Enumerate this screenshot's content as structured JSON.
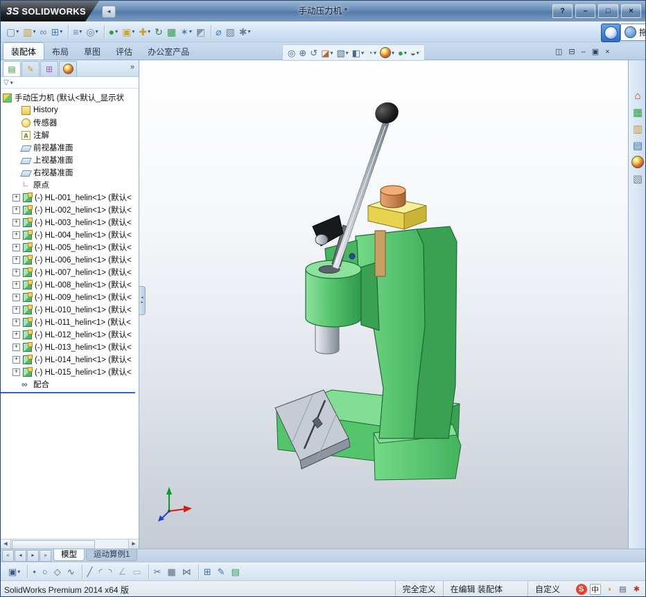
{
  "titlebar": {
    "logo": "3S",
    "brand": "SOLIDWORKS",
    "title": "手动压力机 *",
    "controls": [
      {
        "name": "help-button",
        "glyph": "?"
      },
      {
        "name": "minimize-button",
        "glyph": "–"
      },
      {
        "name": "maximize-button",
        "glyph": "□"
      },
      {
        "name": "close-button",
        "glyph": "×"
      }
    ]
  },
  "main_toolbar": {
    "icons": [
      {
        "name": "new-document-icon",
        "glyph": "▢",
        "color": "#7d8893",
        "caret": true
      },
      {
        "name": "open-document-icon",
        "glyph": "▥",
        "color": "#c9992e",
        "caret": true
      },
      {
        "name": "attachment-icon",
        "glyph": "∞",
        "color": "#70809a"
      },
      {
        "name": "component-pattern-icon",
        "glyph": "⊞",
        "color": "#3f7fbf",
        "caret": true
      },
      {
        "sep": true
      },
      {
        "name": "print-icon",
        "glyph": "≡",
        "color": "#70809a",
        "caret": true
      },
      {
        "name": "print-preview-icon",
        "glyph": "◎",
        "color": "#70809a",
        "caret": true
      },
      {
        "sep": true
      },
      {
        "name": "apply-scene-icon",
        "glyph": "●",
        "color": "#2f9e44",
        "caret": true
      },
      {
        "name": "insert-components-icon",
        "glyph": "▣",
        "color": "#caa53d",
        "caret": true
      },
      {
        "name": "smart-fasteners-icon",
        "glyph": "✚",
        "color": "#d29a2b",
        "caret": true
      },
      {
        "name": "rebuild-icon",
        "glyph": "↻",
        "color": "#2e7f52"
      },
      {
        "name": "design-table-icon",
        "glyph": "▦",
        "color": "#2f9e44"
      },
      {
        "name": "exploded-view-icon",
        "glyph": "✶",
        "color": "#3f7fbf",
        "caret": true
      },
      {
        "name": "interference-detection-icon",
        "glyph": "◩",
        "color": "#8a93a0"
      },
      {
        "sep": true
      },
      {
        "name": "measure-icon",
        "glyph": "⌀",
        "color": "#3f7fbf"
      },
      {
        "name": "section-properties-icon",
        "glyph": "▨",
        "color": "#70809a"
      },
      {
        "name": "options-icon",
        "glyph": "✱",
        "color": "#70809a",
        "caret": true
      }
    ]
  },
  "drag_hint": {
    "label": "拖拽"
  },
  "command_tabs": [
    {
      "name": "tab-assembly",
      "label": "装配体",
      "active": true
    },
    {
      "name": "tab-layout",
      "label": "布局"
    },
    {
      "name": "tab-sketch",
      "label": "草图"
    },
    {
      "name": "tab-evaluate",
      "label": "评估"
    },
    {
      "name": "tab-office-products",
      "label": "办公室产品"
    }
  ],
  "view_toolbar": {
    "icons": [
      {
        "name": "zoom-to-fit-icon",
        "glyph": "◎",
        "color": "#3f6fa0"
      },
      {
        "name": "zoom-to-area-icon",
        "glyph": "⊕",
        "color": "#3f6fa0"
      },
      {
        "name": "previous-view-icon",
        "glyph": "↺",
        "color": "#3f6fa0"
      },
      {
        "name": "section-view-icon",
        "glyph": "◪",
        "color": "#b06a3a",
        "caret": true
      },
      {
        "name": "view-orientation-icon",
        "glyph": "▧",
        "color": "#4a6b8a",
        "caret": true
      },
      {
        "name": "display-style-icon",
        "glyph": "◧",
        "color": "#4a6b8a",
        "caret": true
      },
      {
        "name": "hide-show-items-icon",
        "glyph": "◔",
        "color": "#7a8694",
        "caret": true
      },
      {
        "name": "edit-appearance-icon",
        "ball": true,
        "caret": true
      },
      {
        "name": "apply-scene-view-icon",
        "glyph": "●",
        "color": "#2f9e44",
        "caret": true
      },
      {
        "name": "view-settings-icon",
        "glyph": "◒",
        "color": "#4a6b8a",
        "caret": true
      }
    ]
  },
  "doc_controls": [
    {
      "name": "split-view-icon",
      "glyph": "◫",
      "color": "#27415e"
    },
    {
      "name": "tile-view-icon",
      "glyph": "⊟",
      "color": "#27415e"
    },
    {
      "name": "doc-minimize-icon",
      "glyph": "–",
      "color": "#27415e"
    },
    {
      "name": "doc-restore-icon",
      "glyph": "▣",
      "color": "#27415e"
    },
    {
      "name": "doc-close-icon",
      "glyph": "×",
      "color": "#27415e"
    }
  ],
  "panel": {
    "flyout": "»",
    "filter_funnel": "▽",
    "filter_caret": "▾",
    "tabs": [
      {
        "name": "featuremanager-tab",
        "glyph": "▤",
        "color": "#2f9e44",
        "active": true
      },
      {
        "name": "propertymanager-tab",
        "glyph": "✎",
        "color": "#d4a017"
      },
      {
        "name": "configurationmanager-tab",
        "glyph": "⊞",
        "color": "#9b59b6"
      },
      {
        "name": "appearances-tab",
        "ball": true
      }
    ]
  },
  "tree": {
    "root": {
      "label": "手动压力机 (默认<默认_显示状",
      "icon": "assembly"
    },
    "items": [
      {
        "label": "History",
        "icon": "history"
      },
      {
        "label": "传感器",
        "icon": "sensors"
      },
      {
        "label": "注解",
        "icon": "annotations"
      },
      {
        "label": "前视基准面",
        "icon": "plane"
      },
      {
        "label": "上视基准面",
        "icon": "plane"
      },
      {
        "label": "右视基准面",
        "icon": "plane"
      },
      {
        "label": "原点",
        "icon": "origin"
      },
      {
        "label": "(-) HL-001_helin<1> (默认<",
        "icon": "component",
        "expandable": true
      },
      {
        "label": "(-) HL-002_helin<1> (默认<",
        "icon": "component",
        "expandable": true
      },
      {
        "label": "(-) HL-003_helin<1> (默认<",
        "icon": "component",
        "expandable": true
      },
      {
        "label": "(-) HL-004_helin<1> (默认<",
        "icon": "component",
        "expandable": true
      },
      {
        "label": "(-) HL-005_helin<1> (默认<",
        "icon": "component",
        "expandable": true
      },
      {
        "label": "(-) HL-006_helin<1> (默认<",
        "icon": "component",
        "expandable": true
      },
      {
        "label": "(-) HL-007_helin<1> (默认<",
        "icon": "component",
        "expandable": true
      },
      {
        "label": "(-) HL-008_helin<1> (默认<",
        "icon": "component",
        "expandable": true
      },
      {
        "label": "(-) HL-009_helin<1> (默认<",
        "icon": "component",
        "expandable": true
      },
      {
        "label": "(-) HL-010_helin<1> (默认<",
        "icon": "component",
        "expandable": true
      },
      {
        "label": "(-) HL-011_helin<1> (默认<",
        "icon": "component",
        "expandable": true
      },
      {
        "label": "(-) HL-012_helin<1> (默认<",
        "icon": "component",
        "expandable": true
      },
      {
        "label": "(-) HL-013_helin<1> (默认<",
        "icon": "component",
        "expandable": true
      },
      {
        "label": "(-) HL-014_helin<1> (默认<",
        "icon": "component",
        "expandable": true
      },
      {
        "label": "(-) HL-015_helin<1> (默认<",
        "icon": "component",
        "expandable": true
      },
      {
        "label": "配合",
        "icon": "mates"
      }
    ]
  },
  "task_pane": {
    "icons": [
      {
        "name": "home-icon",
        "glyph": "⌂",
        "color": "#c0392b"
      },
      {
        "name": "solidworks-resources-icon",
        "glyph": "▦",
        "color": "#2f9e44"
      },
      {
        "name": "design-library-icon",
        "glyph": "▥",
        "color": "#c9992e"
      },
      {
        "name": "file-explorer-icon",
        "glyph": "▤",
        "color": "#3f6fa0"
      },
      {
        "name": "appearances-scenes-icon",
        "ball": true
      },
      {
        "name": "custom-properties-icon",
        "glyph": "▧",
        "color": "#7a8694"
      }
    ]
  },
  "bottom_tabs": {
    "nav": [
      {
        "name": "first-tab-button",
        "glyph": "«"
      },
      {
        "name": "previous-tab-button",
        "glyph": "◂"
      },
      {
        "name": "next-tab-button",
        "glyph": "▸"
      },
      {
        "name": "last-tab-button",
        "glyph": "»"
      }
    ],
    "tabs": [
      {
        "name": "tab-model",
        "label": "模型",
        "active": true
      },
      {
        "name": "tab-motion-study-1",
        "label": "运动算例1"
      }
    ]
  },
  "sketch_toolbar": {
    "icons": [
      {
        "name": "save-icon",
        "glyph": "▣",
        "color": "#3b5f8f",
        "caret": true
      },
      {
        "sep": true
      },
      {
        "name": "point-icon",
        "glyph": "•",
        "color": "#5a6b7d"
      },
      {
        "name": "circle-icon",
        "glyph": "○",
        "color": "#5a6b7d"
      },
      {
        "name": "polygon-icon",
        "glyph": "◇",
        "color": "#5a6b7d"
      },
      {
        "name": "spline-icon",
        "glyph": "∿",
        "color": "#5a6b7d"
      },
      {
        "sep": true
      },
      {
        "name": "line-icon",
        "glyph": "╱",
        "color": "#5a6b7d"
      },
      {
        "name": "arc-icon",
        "glyph": "◜",
        "color": "#5a6b7d"
      },
      {
        "name": "tangent-arc-icon",
        "glyph": "◝",
        "color": "#5a6b7d"
      },
      {
        "name": "angle-snap-icon",
        "glyph": "∠",
        "color": "#9fb0c0"
      },
      {
        "name": "rectangle-icon",
        "glyph": "▭",
        "color": "#9fb0c0"
      },
      {
        "sep": true
      },
      {
        "name": "trim-entities-icon",
        "glyph": "✂",
        "color": "#5a6b7d"
      },
      {
        "name": "linear-pattern-icon",
        "glyph": "▦",
        "color": "#5a6b7d"
      },
      {
        "name": "mirror-entities-icon",
        "glyph": "⋈",
        "color": "#5a6b7d"
      },
      {
        "sep": true
      },
      {
        "name": "grid-system-icon",
        "glyph": "⊞",
        "color": "#3f6fa0"
      },
      {
        "name": "instant2d-icon",
        "glyph": "✎",
        "color": "#3f6fa0"
      },
      {
        "name": "table-icon",
        "glyph": "▤",
        "color": "#2f9e44"
      }
    ]
  },
  "statusbar": {
    "left": "SolidWorks Premium 2014 x64 版",
    "segments": [
      {
        "label": "完全定义"
      },
      {
        "label": "在编辑 装配体"
      },
      {
        "label": "自定义"
      }
    ],
    "ime": [
      {
        "name": "ime-sogou-icon",
        "glyph": "S",
        "bg": "#e2442f",
        "fg": "#ffffff",
        "round": true
      },
      {
        "name": "ime-language-icon",
        "glyph": "中",
        "bg": "#ffffff",
        "fg": "#222222"
      },
      {
        "name": "ime-halfwidth-icon",
        "glyph": "◑",
        "color": "#d4a017"
      },
      {
        "name": "ime-keyboard-icon",
        "glyph": "▤",
        "color": "#44566b"
      },
      {
        "name": "ime-settings-icon",
        "glyph": "✱",
        "color": "#b03a2e"
      }
    ]
  }
}
